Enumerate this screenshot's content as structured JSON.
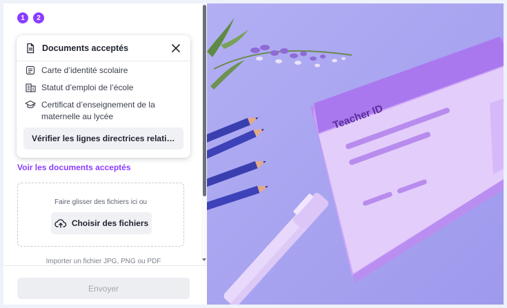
{
  "steps": [
    "1",
    "2"
  ],
  "popover": {
    "title": "Documents acceptés",
    "items": [
      {
        "icon": "document-lines-icon",
        "label": "Carte d’identité scolaire"
      },
      {
        "icon": "building-icon",
        "label": "Statut d’emploi de l’école"
      },
      {
        "icon": "graduation-cap-icon",
        "label": "Certificat d’enseignement de la maternelle au lycée"
      }
    ],
    "guidelines_button": "Vérifier les lignes directrices relatives à l’éligibilité"
  },
  "see_documents_link": "Voir les documents acceptés",
  "dropzone": {
    "hint": "Faire glisser des fichiers ici ou",
    "choose_button": "Choisir des fichiers"
  },
  "format_note": "Importer un fichier JPG, PNG ou PDF",
  "submit_button": "Envoyer",
  "illustration": {
    "card_title": "Teacher ID"
  },
  "colors": {
    "accent": "#8b3dff",
    "illustration_bg": "#a8a4f0",
    "card": "#c9a0f5"
  }
}
